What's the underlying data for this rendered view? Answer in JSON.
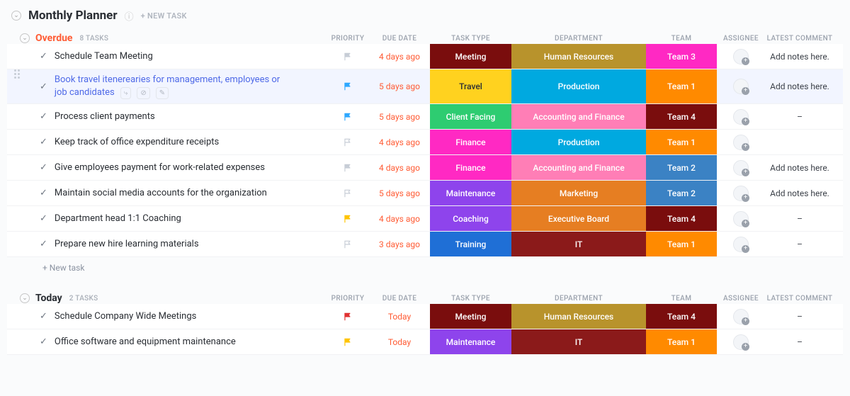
{
  "pageTitle": "Monthly Planner",
  "newTaskTop": "+ NEW TASK",
  "newTaskRow": "+ New task",
  "columns": {
    "priority": "PRIORITY",
    "due": "DUE DATE",
    "type": "TASK TYPE",
    "dept": "DEPARTMENT",
    "team": "TEAM",
    "assignee": "ASSIGNEE",
    "comment": "LATEST COMMENT"
  },
  "groups": [
    {
      "key": "overdue",
      "title": "Overdue",
      "countLabel": "8 TASKS",
      "titleClass": "overdue",
      "tasks": [
        {
          "name": "Schedule Team Meeting",
          "priority": "gray",
          "due": "4 days ago",
          "type": {
            "label": "Meeting",
            "bg": "bg-darkred"
          },
          "dept": {
            "label": "Human Resources",
            "bg": "bg-gold"
          },
          "team": {
            "label": "Team 3",
            "bg": "bg-magenta"
          },
          "comment": "Add notes here."
        },
        {
          "name": "Book travel itenerearies for management, employees or job candidates",
          "hovered": true,
          "link": true,
          "priority": "blue",
          "due": "5 days ago",
          "type": {
            "label": "Travel",
            "bg": "bg-yellow"
          },
          "dept": {
            "label": "Production",
            "bg": "bg-cyan"
          },
          "team": {
            "label": "Team 1",
            "bg": "bg-orange"
          },
          "comment": "Add notes here."
        },
        {
          "name": "Process client payments",
          "priority": "blue",
          "due": "5 days ago",
          "type": {
            "label": "Client Facing",
            "bg": "bg-green"
          },
          "dept": {
            "label": "Accounting and Finance",
            "bg": "bg-pink"
          },
          "team": {
            "label": "Team 4",
            "bg": "bg-maroon"
          },
          "comment": "–"
        },
        {
          "name": "Keep track of office expenditure receipts",
          "priority": "outline",
          "due": "4 days ago",
          "type": {
            "label": "Finance",
            "bg": "bg-magenta"
          },
          "dept": {
            "label": "Production",
            "bg": "bg-cyan"
          },
          "team": {
            "label": "Team 1",
            "bg": "bg-orange"
          },
          "comment": ""
        },
        {
          "name": "Give employees payment for work-related expenses",
          "priority": "gray",
          "due": "4 days ago",
          "type": {
            "label": "Finance",
            "bg": "bg-magenta"
          },
          "dept": {
            "label": "Accounting and Finance",
            "bg": "bg-pink"
          },
          "team": {
            "label": "Team 2",
            "bg": "bg-steelblue"
          },
          "comment": "Add notes here."
        },
        {
          "name": "Maintain social media accounts for the organization",
          "priority": "outline",
          "due": "5 days ago",
          "type": {
            "label": "Maintenance",
            "bg": "bg-purple"
          },
          "dept": {
            "label": "Marketing",
            "bg": "bg-deeporange"
          },
          "team": {
            "label": "Team 2",
            "bg": "bg-steelblue"
          },
          "comment": "Add notes here."
        },
        {
          "name": "Department head 1:1 Coaching",
          "priority": "yellow",
          "due": "4 days ago",
          "type": {
            "label": "Coaching",
            "bg": "bg-purple"
          },
          "dept": {
            "label": "Executive Board",
            "bg": "bg-deeporange"
          },
          "team": {
            "label": "Team 4",
            "bg": "bg-maroon"
          },
          "comment": "–"
        },
        {
          "name": "Prepare new hire learning materials",
          "priority": "outline",
          "due": "3 days ago",
          "type": {
            "label": "Training",
            "bg": "bg-blue"
          },
          "dept": {
            "label": "IT",
            "bg": "bg-darkred2"
          },
          "team": {
            "label": "Team 1",
            "bg": "bg-orange"
          },
          "comment": "–"
        }
      ]
    },
    {
      "key": "today",
      "title": "Today",
      "countLabel": "2 TASKS",
      "titleClass": "today",
      "tasks": [
        {
          "name": "Schedule Company Wide Meetings",
          "priority": "red",
          "due": "Today",
          "type": {
            "label": "Meeting",
            "bg": "bg-darkred"
          },
          "dept": {
            "label": "Human Resources",
            "bg": "bg-gold"
          },
          "team": {
            "label": "Team 4",
            "bg": "bg-maroon"
          },
          "comment": "–"
        },
        {
          "name": "Office software and equipment maintenance",
          "priority": "yellow",
          "due": "Today",
          "type": {
            "label": "Maintenance",
            "bg": "bg-purple"
          },
          "dept": {
            "label": "IT",
            "bg": "bg-darkred2"
          },
          "team": {
            "label": "Team 1",
            "bg": "bg-orange"
          },
          "comment": "–"
        }
      ]
    }
  ]
}
